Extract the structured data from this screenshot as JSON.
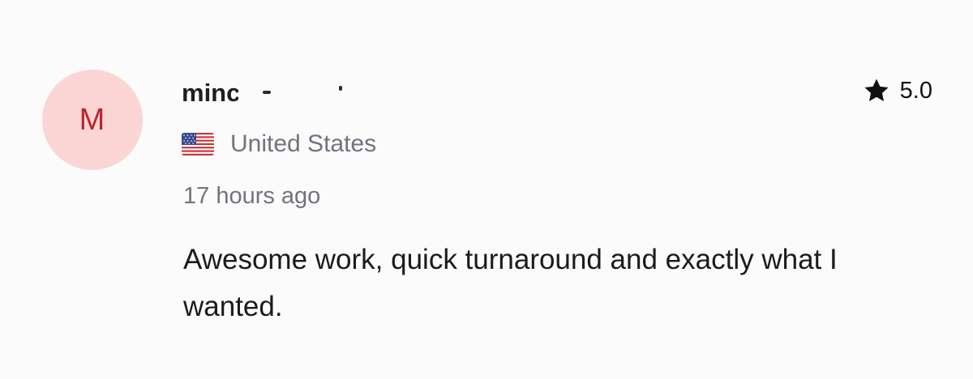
{
  "review": {
    "avatar_letter": "M",
    "username": "minc",
    "rating": "5.0",
    "country": "United States",
    "flag_icon": "us-flag-icon",
    "timestamp": "17 hours ago",
    "text": "Awesome work, quick turnaround and exactly what I wanted."
  },
  "colors": {
    "avatar_bg": "#fbd5d4",
    "avatar_letter": "#b8262e",
    "muted_text": "#73727d",
    "body_text": "#1b1b1b"
  }
}
